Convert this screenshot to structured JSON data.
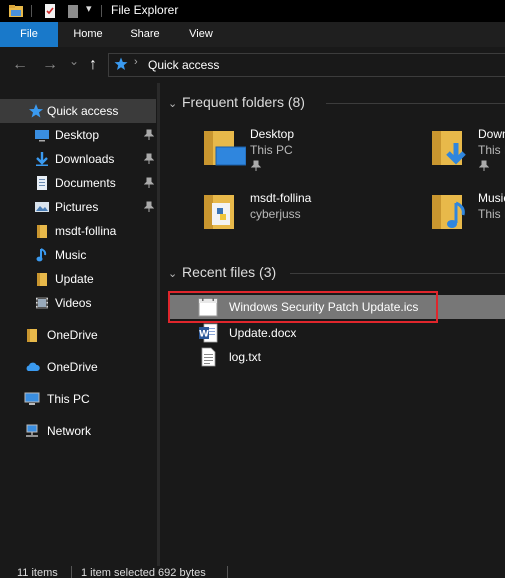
{
  "window": {
    "title": "File Explorer"
  },
  "ribbon": {
    "tabs": [
      "File",
      "Home",
      "Share",
      "View"
    ]
  },
  "address": {
    "path": "Quick access",
    "separator": "›"
  },
  "nav": {
    "back": "←",
    "forward": "→",
    "recent": "⌄",
    "up": "↑"
  },
  "sidebar": {
    "items": [
      {
        "label": "Quick access",
        "icon": "star-icon",
        "pinned": false
      },
      {
        "label": "Desktop",
        "icon": "desktop-icon",
        "pinned": true
      },
      {
        "label": "Downloads",
        "icon": "download-icon",
        "pinned": true
      },
      {
        "label": "Documents",
        "icon": "documents-icon",
        "pinned": true
      },
      {
        "label": "Pictures",
        "icon": "pictures-icon",
        "pinned": true
      },
      {
        "label": "msdt-follina",
        "icon": "folder-icon",
        "pinned": false
      },
      {
        "label": "Music",
        "icon": "music-icon",
        "pinned": false
      },
      {
        "label": "Update",
        "icon": "folder-icon",
        "pinned": false
      },
      {
        "label": "Videos",
        "icon": "videos-icon",
        "pinned": false
      },
      {
        "label": "OneDrive",
        "icon": "folder-icon",
        "pinned": false
      },
      {
        "label": "OneDrive",
        "icon": "cloud-icon",
        "pinned": false
      },
      {
        "label": "This PC",
        "icon": "computer-icon",
        "pinned": false
      },
      {
        "label": "Network",
        "icon": "network-icon",
        "pinned": false
      }
    ]
  },
  "frequent": {
    "header": "Frequent folders (8)",
    "chevron": "⌄",
    "tiles": [
      {
        "name": "Desktop",
        "sub": "This PC",
        "pinned": true,
        "icon": "desktop-folder-icon"
      },
      {
        "name": "Down",
        "sub": "This P",
        "pinned": true,
        "icon": "downloads-folder-icon"
      },
      {
        "name": "msdt-follina",
        "sub": "cyberjuss",
        "pinned": false,
        "icon": "python-folder-icon"
      },
      {
        "name": "Music",
        "sub": "This P",
        "pinned": false,
        "icon": "music-folder-icon"
      }
    ]
  },
  "recent": {
    "header": "Recent files (3)",
    "chevron": "⌄",
    "files": [
      {
        "name": "Windows Security Patch Update.ics",
        "icon": "calendar-file-icon",
        "selected": true
      },
      {
        "name": "Update.docx",
        "icon": "word-file-icon",
        "selected": false
      },
      {
        "name": "log.txt",
        "icon": "text-file-icon",
        "selected": false
      }
    ]
  },
  "status": {
    "items_count": "11 items",
    "selection": "1 item selected  692 bytes"
  },
  "colors": {
    "accent": "#1979ca",
    "selection_highlight": "#e0262c",
    "folder": "#e8b94a"
  }
}
